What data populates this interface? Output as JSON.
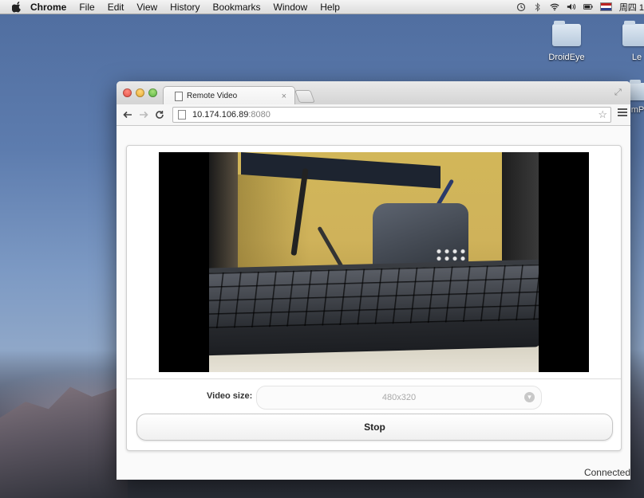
{
  "menubar": {
    "app_name": "Chrome",
    "items": [
      "File",
      "Edit",
      "View",
      "History",
      "Bookmarks",
      "Window",
      "Help"
    ],
    "status_icons": [
      "time-machine-icon",
      "bluetooth-icon",
      "wifi-icon",
      "volume-icon",
      "battery-icon",
      "flag-icon"
    ],
    "clock": "周四 1"
  },
  "desktop": {
    "icons": [
      {
        "label": "DroidEye"
      },
      {
        "label": "Le"
      }
    ],
    "partial_label": "mP"
  },
  "browser": {
    "tab_title": "Remote Video",
    "address_host": "10.174.106.89",
    "address_port": ":8080"
  },
  "page": {
    "video_size_label": "Video size:",
    "video_size_value": "480x320",
    "stop_label": "Stop",
    "status": "Connected"
  }
}
